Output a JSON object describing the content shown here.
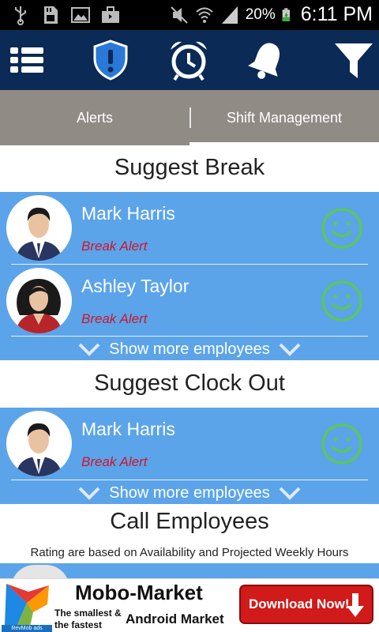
{
  "status_bar": {
    "icons": [
      "usb-icon",
      "sd-card-icon",
      "image-icon",
      "briefcase-icon",
      "mute-icon",
      "wifi-icon",
      "signal-icon",
      "battery-charging-icon"
    ],
    "battery_percent": "20%",
    "time": "6:11 PM"
  },
  "toolbar": {
    "icons": [
      "list-icon",
      "shield-alert-icon",
      "alarm-clock-icon",
      "bell-icon",
      "filter-icon"
    ],
    "background": "#0b2a55"
  },
  "tabs": [
    {
      "label": "Alerts",
      "selected": false
    },
    {
      "label": "Shift Management",
      "selected": true
    }
  ],
  "sections": {
    "suggest_break": {
      "title": "Suggest Break",
      "employees": [
        {
          "name": "Mark Harris",
          "status": "Break Alert",
          "avatar": "male-avatar"
        },
        {
          "name": "Ashley Taylor",
          "status": "Break Alert",
          "avatar": "female-avatar"
        }
      ],
      "show_more": "Show more employees"
    },
    "suggest_clock_out": {
      "title": "Suggest Clock Out",
      "employees": [
        {
          "name": "Mark Harris",
          "status": "Break Alert",
          "avatar": "male-avatar"
        }
      ],
      "show_more": "Show more employees"
    },
    "call_employees": {
      "title": "Call Employees",
      "note": "Rating are based on Availability and Projected Weekly Hours"
    }
  },
  "ad": {
    "title": "Mobo-Market",
    "tagline_1": "The smallest &",
    "tagline_2": "the fastest",
    "market": "Android Market",
    "button": "Download Now!",
    "network": "RevMob ads"
  },
  "colors": {
    "panel": "#5ba4ea",
    "status_text": "#d0152a",
    "smiley": "#5ccb4a",
    "tabs_bg": "#918b86"
  }
}
